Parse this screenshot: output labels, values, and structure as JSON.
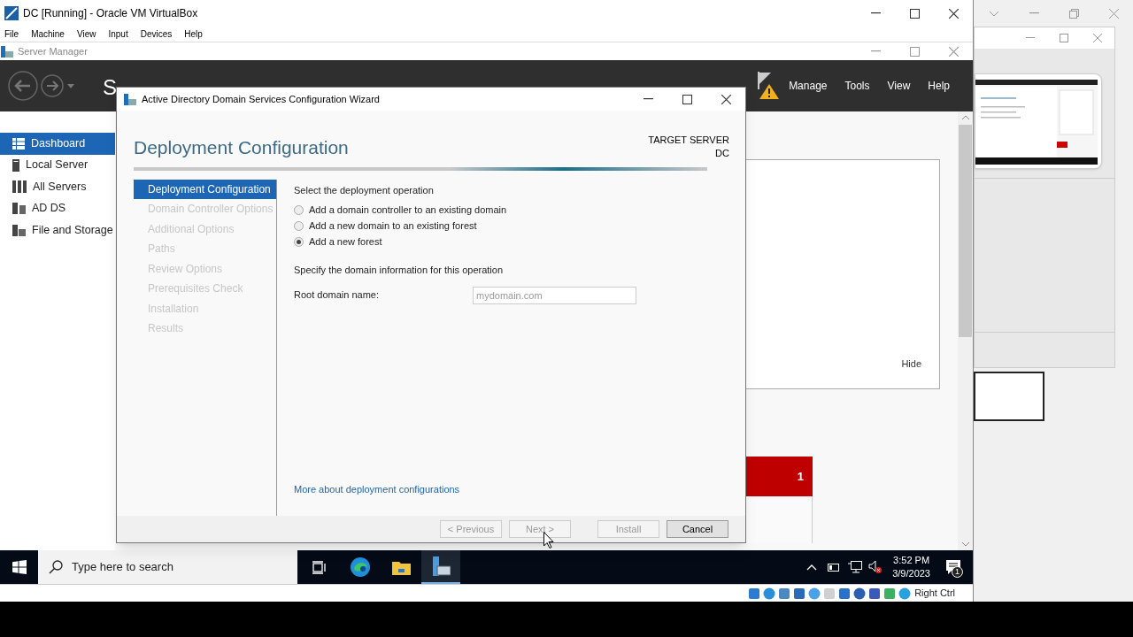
{
  "vbox": {
    "title": "DC [Running] - Oracle VM VirtualBox",
    "menu": [
      "File",
      "Machine",
      "View",
      "Input",
      "Devices",
      "Help"
    ],
    "status_text": "Right Ctrl"
  },
  "server_manager": {
    "title": "Server Manager",
    "breadcrumb": "S",
    "header_menu": [
      "Manage",
      "Tools",
      "View",
      "Help"
    ],
    "nav": [
      {
        "label": "Dashboard",
        "selected": true,
        "kind": "dashboard"
      },
      {
        "label": "Local Server",
        "selected": false,
        "kind": "server"
      },
      {
        "label": "All Servers",
        "selected": false,
        "kind": "servers"
      },
      {
        "label": "AD DS",
        "selected": false,
        "kind": "adds"
      },
      {
        "label": "File and Storage",
        "selected": false,
        "kind": "storage"
      }
    ],
    "hide_label": "Hide",
    "tile_count": "1"
  },
  "wizard": {
    "title": "Active Directory Domain Services Configuration Wizard",
    "heading": "Deployment Configuration",
    "target_label": "TARGET SERVER",
    "target_name": "DC",
    "steps": [
      {
        "label": "Deployment Configuration",
        "selected": true,
        "disabled": false
      },
      {
        "label": "Domain Controller Options",
        "selected": false,
        "disabled": true
      },
      {
        "label": "Additional Options",
        "selected": false,
        "disabled": true
      },
      {
        "label": "Paths",
        "selected": false,
        "disabled": true
      },
      {
        "label": "Review Options",
        "selected": false,
        "disabled": true
      },
      {
        "label": "Prerequisites Check",
        "selected": false,
        "disabled": true
      },
      {
        "label": "Installation",
        "selected": false,
        "disabled": true
      },
      {
        "label": "Results",
        "selected": false,
        "disabled": true
      }
    ],
    "operation_prompt": "Select the deployment operation",
    "options": [
      {
        "label": "Add a domain controller to an existing domain",
        "selected": false
      },
      {
        "label": "Add a new domain to an existing forest",
        "selected": false
      },
      {
        "label": "Add a new forest",
        "selected": true
      }
    ],
    "domain_prompt": "Specify the domain information for this operation",
    "root_domain": {
      "label": "Root domain name:",
      "placeholder": "mydomain.com"
    },
    "link": "More about deployment configurations",
    "buttons": [
      {
        "label": "< Previous",
        "disabled": true
      },
      {
        "label": "Next >",
        "disabled": true
      },
      {
        "label": "Install",
        "disabled": true
      },
      {
        "label": "Cancel",
        "disabled": false
      }
    ]
  },
  "taskbar": {
    "search_placeholder": "Type here to search",
    "time": "3:52 PM",
    "date": "3/9/2023",
    "notification_count": "1"
  }
}
